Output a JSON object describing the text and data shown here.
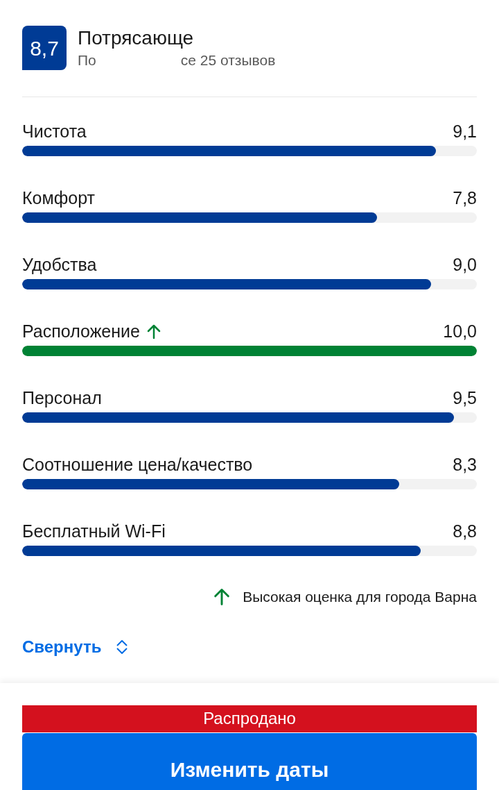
{
  "score": {
    "value": "8,7",
    "title": "Потрясающе",
    "subtitle_parts": [
      "По",
      "се 25 отзывов"
    ]
  },
  "categories": [
    {
      "label": "Чистота",
      "reading": "9,1",
      "level": 0.91,
      "highlight": false
    },
    {
      "label": "Комфорт",
      "reading": "7,8",
      "level": 0.78,
      "highlight": false
    },
    {
      "label": "Удобства",
      "reading": "9,0",
      "level": 0.9,
      "highlight": false
    },
    {
      "label": "Расположение",
      "reading": "10,0",
      "level": 1,
      "highlight": true
    },
    {
      "label": "Персонал",
      "reading": "9,5",
      "level": 0.95,
      "highlight": false
    },
    {
      "label": "Соотношение цена/качество",
      "reading": "8,3",
      "level": 0.83,
      "highlight": false
    },
    {
      "label": "Бесплатный Wi-Fi",
      "reading": "8,8",
      "level": 0.876,
      "highlight": false
    }
  ],
  "legend": "Высокая оценка для города Варна",
  "collapse_link": "Свернуть",
  "sold_out_banner": "Распродано",
  "change_dates_button": "Изменить даты"
}
